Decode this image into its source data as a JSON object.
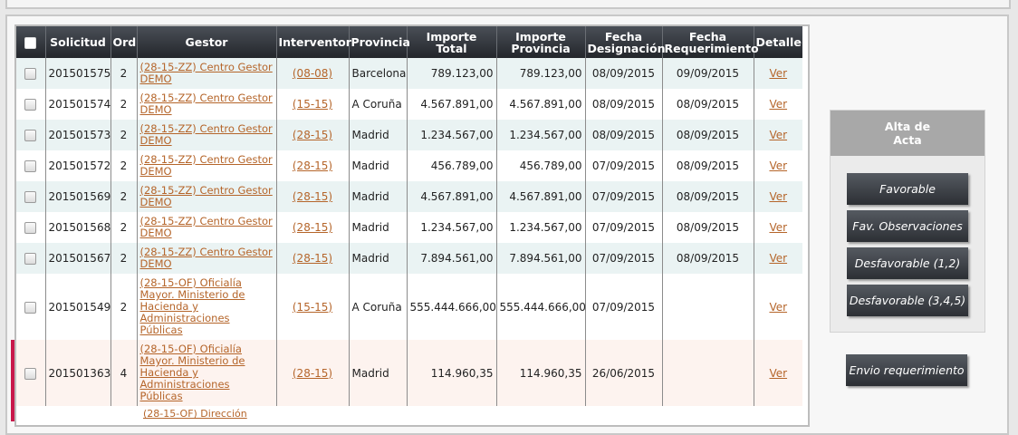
{
  "table": {
    "headers": {
      "solicitud": "Solicitud",
      "ord": "Ord",
      "gestor": "Gestor",
      "interventor": "Interventor",
      "provincia": "Provincia",
      "importe_total": "Importe Total",
      "importe_provincia": "Importe\nProvincia",
      "fecha_designacion": "Fecha\nDesignación",
      "fecha_requerimiento": "Fecha\nRequerimiento",
      "detalle": "Detalle"
    },
    "rows": [
      {
        "solicitud": "201501575",
        "ord": "2",
        "gestor": "(28-15-ZZ) Centro Gestor DEMO",
        "interventor": "(08-08)",
        "provincia": "Barcelona",
        "importe_total": "789.123,00",
        "importe_provincia": "789.123,00",
        "fecha_designacion": "08/09/2015",
        "fecha_requerimiento": "09/09/2015",
        "detalle": "Ver"
      },
      {
        "solicitud": "201501574",
        "ord": "2",
        "gestor": "(28-15-ZZ) Centro Gestor DEMO",
        "interventor": "(15-15)",
        "provincia": "A Coruña",
        "importe_total": "4.567.891,00",
        "importe_provincia": "4.567.891,00",
        "fecha_designacion": "08/09/2015",
        "fecha_requerimiento": "08/09/2015",
        "detalle": "Ver"
      },
      {
        "solicitud": "201501573",
        "ord": "2",
        "gestor": "(28-15-ZZ) Centro Gestor DEMO",
        "interventor": "(28-15)",
        "provincia": "Madrid",
        "importe_total": "1.234.567,00",
        "importe_provincia": "1.234.567,00",
        "fecha_designacion": "08/09/2015",
        "fecha_requerimiento": "08/09/2015",
        "detalle": "Ver"
      },
      {
        "solicitud": "201501572",
        "ord": "2",
        "gestor": "(28-15-ZZ) Centro Gestor DEMO",
        "interventor": "(28-15)",
        "provincia": "Madrid",
        "importe_total": "456.789,00",
        "importe_provincia": "456.789,00",
        "fecha_designacion": "07/09/2015",
        "fecha_requerimiento": "08/09/2015",
        "detalle": "Ver"
      },
      {
        "solicitud": "201501569",
        "ord": "2",
        "gestor": "(28-15-ZZ) Centro Gestor DEMO",
        "interventor": "(28-15)",
        "provincia": "Madrid",
        "importe_total": "4.567.891,00",
        "importe_provincia": "4.567.891,00",
        "fecha_designacion": "07/09/2015",
        "fecha_requerimiento": "08/09/2015",
        "detalle": "Ver"
      },
      {
        "solicitud": "201501568",
        "ord": "2",
        "gestor": "(28-15-ZZ) Centro Gestor DEMO",
        "interventor": "(28-15)",
        "provincia": "Madrid",
        "importe_total": "1.234.567,00",
        "importe_provincia": "1.234.567,00",
        "fecha_designacion": "07/09/2015",
        "fecha_requerimiento": "08/09/2015",
        "detalle": "Ver"
      },
      {
        "solicitud": "201501567",
        "ord": "2",
        "gestor": "(28-15-ZZ) Centro Gestor DEMO",
        "interventor": "(28-15)",
        "provincia": "Madrid",
        "importe_total": "7.894.561,00",
        "importe_provincia": "7.894.561,00",
        "fecha_designacion": "07/09/2015",
        "fecha_requerimiento": "08/09/2015",
        "detalle": "Ver"
      },
      {
        "solicitud": "201501549",
        "ord": "2",
        "gestor": "(28-15-OF) Oficialía Mayor. Ministerio de Hacienda y Administraciones Públicas",
        "interventor": "(15-15)",
        "provincia": "A Coruña",
        "importe_total": "555.444.666,00",
        "importe_provincia": "555.444.666,00",
        "fecha_designacion": "07/09/2015",
        "fecha_requerimiento": "",
        "detalle": "Ver"
      },
      {
        "solicitud": "201501363",
        "ord": "4",
        "gestor": "(28-15-OF) Oficialía Mayor. Ministerio de Hacienda y Administraciones Públicas",
        "interventor": "(28-15)",
        "provincia": "Madrid",
        "importe_total": "114.960,35",
        "importe_provincia": "114.960,35",
        "fecha_designacion": "26/06/2015",
        "fecha_requerimiento": "",
        "detalle": "Ver"
      }
    ],
    "partial_next_row": "(28-15-OF) Dirección"
  },
  "side_panel": {
    "title": "Alta de\nActa",
    "buttons": [
      "Favorable",
      "Fav. Observaciones",
      "Desfavorable (1,2)",
      "Desfavorable (3,4,5)"
    ]
  },
  "envio_button": "Envio requerimiento",
  "colors": {
    "header_bg": "#2b2e33",
    "link": "#b5652a",
    "row_alt": "#eaf3f3",
    "row_highlight": "#fdf3ef",
    "marker": "#c8174a"
  }
}
